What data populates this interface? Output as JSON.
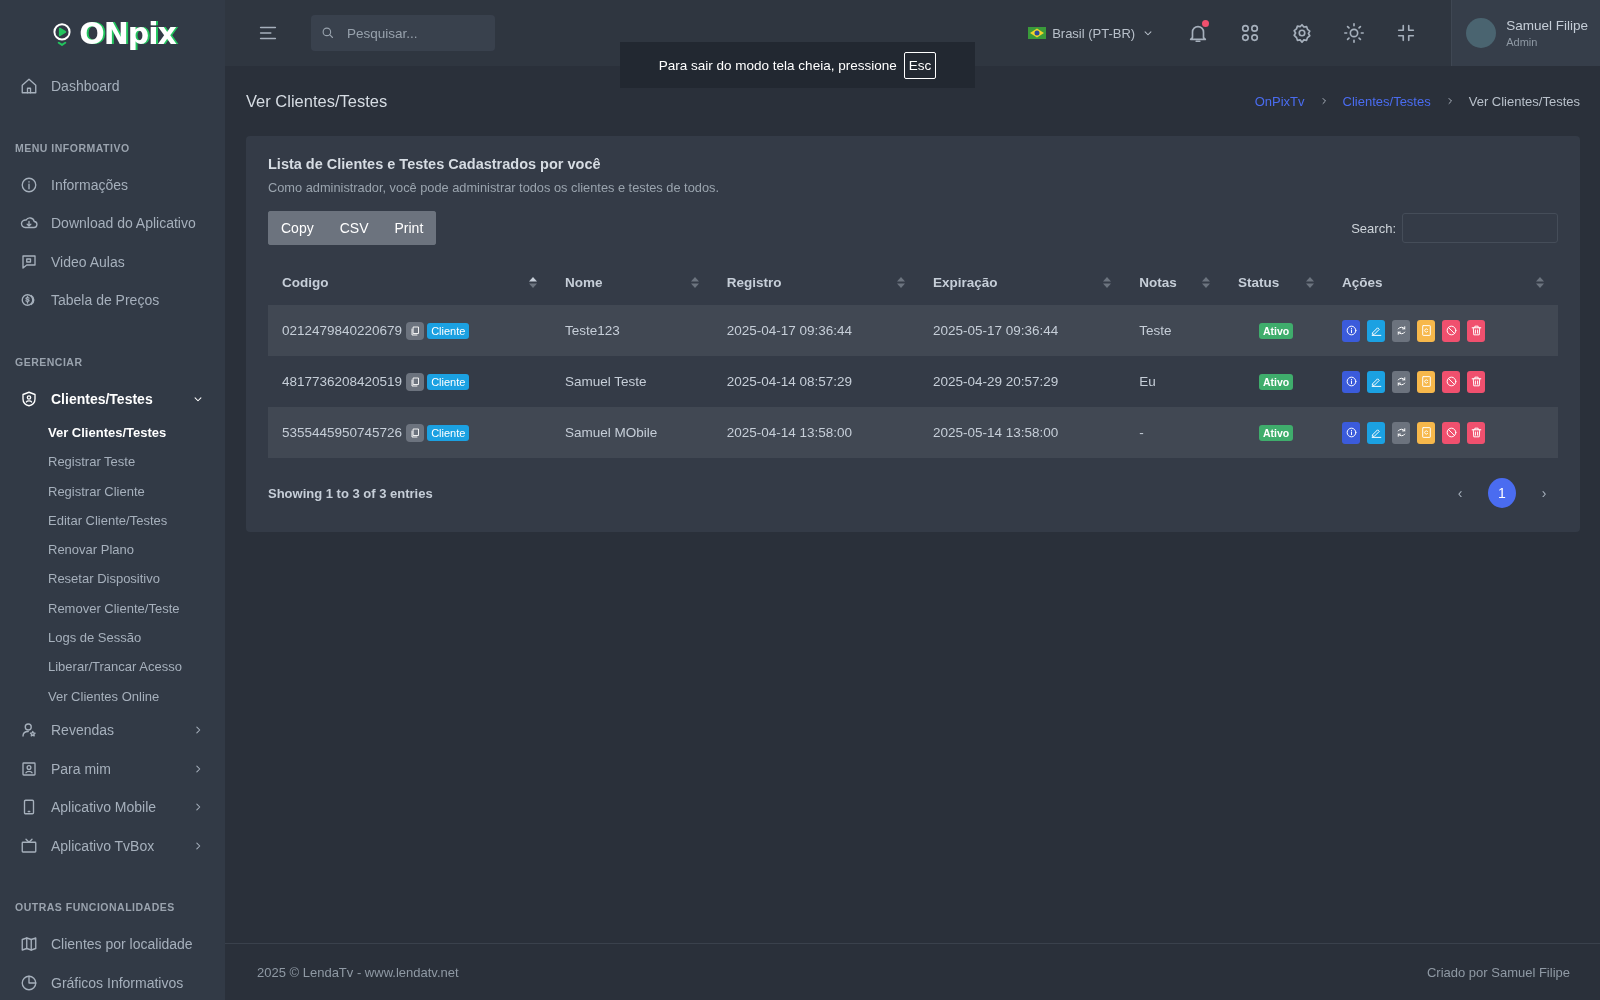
{
  "sidebar": {
    "logo": "ONpix",
    "sections": [
      {
        "items": [
          {
            "label": "Dashboard",
            "selected": false
          }
        ]
      },
      {
        "heading": "MENU INFORMATIVO",
        "items": [
          {
            "label": "Informações",
            "selected": false
          },
          {
            "label": "Download do Aplicativo",
            "selected": false
          },
          {
            "label": "Video Aulas",
            "selected": false
          },
          {
            "label": "Tabela de Preços",
            "selected": false
          }
        ]
      },
      {
        "heading": "GERENCIAR",
        "items": [
          {
            "label": "Clientes/Testes",
            "selected": true,
            "expanded": true,
            "children": [
              {
                "label": "Ver Clientes/Testes",
                "selected": true
              },
              {
                "label": "Registrar Teste",
                "selected": false
              },
              {
                "label": "Registrar Cliente",
                "selected": false
              },
              {
                "label": "Editar Cliente/Testes",
                "selected": false
              },
              {
                "label": "Renovar Plano",
                "selected": false
              },
              {
                "label": "Resetar Dispositivo",
                "selected": false
              },
              {
                "label": "Remover Cliente/Teste",
                "selected": false
              },
              {
                "label": "Logs de Sessão",
                "selected": false
              },
              {
                "label": "Liberar/Trancar Acesso",
                "selected": false
              },
              {
                "label": "Ver Clientes Online",
                "selected": false
              }
            ]
          },
          {
            "label": "Revendas",
            "selected": false,
            "expanded": false
          },
          {
            "label": "Para mim",
            "selected": false,
            "expanded": false
          },
          {
            "label": "Aplicativo Mobile",
            "selected": false,
            "expanded": false
          },
          {
            "label": "Aplicativo TvBox",
            "selected": false,
            "expanded": false
          }
        ]
      },
      {
        "heading": "OUTRAS FUNCIONALIDADES",
        "items": [
          {
            "label": "Clientes por localidade",
            "selected": false
          },
          {
            "label": "Gráficos Informativos",
            "selected": false
          }
        ]
      }
    ]
  },
  "topbar": {
    "search": {
      "placeholder": "Pesquisar..."
    },
    "language": "Brasil (PT-BR)",
    "notification_dot": true,
    "user": {
      "name": "Samuel Filipe",
      "role": "Admin"
    }
  },
  "fullscreen_notice": {
    "text": "Para sair do modo tela cheia, pressione",
    "key": "Esc"
  },
  "page": {
    "title": "Ver Clientes/Testes",
    "breadcrumb": [
      {
        "label": "OnPixTv",
        "link": true
      },
      {
        "label": "Clientes/Testes",
        "link": true
      },
      {
        "label": "Ver Clientes/Testes",
        "link": false
      }
    ]
  },
  "card": {
    "title": "Lista de Clientes e Testes Cadastrados por você",
    "subtitle": "Como administrador, você pode administrar todos os clientes e testes de todos.",
    "export_buttons": [
      "Copy",
      "CSV",
      "Print"
    ],
    "search_label": "Search:",
    "table": {
      "columns": [
        {
          "label": "Codigo",
          "sorted": true
        },
        {
          "label": "Nome",
          "sorted": false
        },
        {
          "label": "Registro",
          "sorted": false
        },
        {
          "label": "Expiração",
          "sorted": false
        },
        {
          "label": "Notas",
          "sorted": false
        },
        {
          "label": "Status",
          "sorted": false
        },
        {
          "label": "Ações",
          "sorted": false
        }
      ],
      "rows": [
        {
          "codigo": "0212479840220679",
          "tag": "Cliente",
          "nome": "Teste123",
          "registro": "2025-04-17 09:36:44",
          "expiracao": "2025-05-17 09:36:44",
          "notas": "Teste",
          "status": "Ativo"
        },
        {
          "codigo": "4817736208420519",
          "tag": "Cliente",
          "nome": "Samuel Teste",
          "registro": "2025-04-14 08:57:29",
          "expiracao": "2025-04-29 20:57:29",
          "notas": "Eu",
          "status": "Ativo"
        },
        {
          "codigo": "5355445950745726",
          "tag": "Cliente",
          "nome": "Samuel MObile",
          "registro": "2025-04-14 13:58:00",
          "expiracao": "2025-05-14 13:58:00",
          "notas": "-",
          "status": "Ativo"
        }
      ],
      "actions": [
        {
          "kind": "info",
          "color": "#3b5bdb"
        },
        {
          "kind": "edit",
          "color": "#1ba1e2"
        },
        {
          "kind": "refresh",
          "color": "#6c737e"
        },
        {
          "kind": "renew",
          "color": "#f7b84b"
        },
        {
          "kind": "block",
          "color": "#f0506e"
        },
        {
          "kind": "delete",
          "color": "#f0506e"
        }
      ]
    },
    "info": "Showing 1 to 3 of 3 entries",
    "pagination": [
      {
        "label": "‹",
        "selected": false
      },
      {
        "label": "1",
        "selected": true
      },
      {
        "label": "›",
        "selected": false
      }
    ]
  },
  "footer": {
    "left": "2025 © LendaTv - www.lendatv.net",
    "right": "Criado por Samuel Filipe"
  }
}
